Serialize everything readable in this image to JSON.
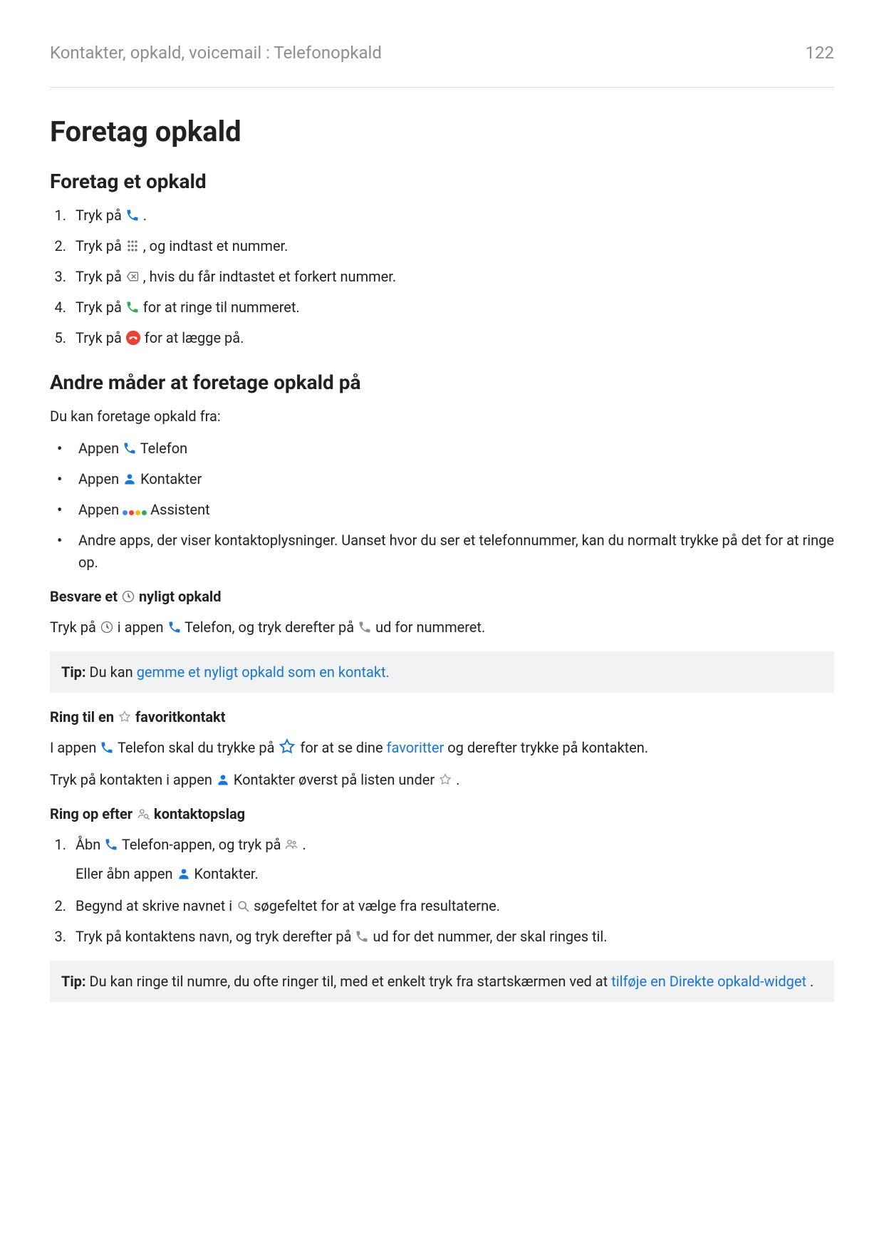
{
  "header": {
    "breadcrumb": "Kontakter, opkald, voicemail : Telefonopkald",
    "page": "122"
  },
  "h1": "Foretag opkald",
  "sec1": {
    "title": "Foretag et opkald",
    "s1a": "Tryk på ",
    "s1b": ".",
    "s2a": "Tryk på ",
    "s2b": ", og indtast et nummer.",
    "s3a": "Tryk på ",
    "s3b": ", hvis du får indtastet et forkert nummer.",
    "s4a": "Tryk på ",
    "s4b": " for at ringe til nummeret.",
    "s5a": "Tryk på ",
    "s5b": " for at lægge på."
  },
  "sec2": {
    "title": "Andre måder at foretage opkald på",
    "intro": "Du kan foretage opkald fra:",
    "b1a": "Appen ",
    "b1b": " Telefon",
    "b2a": "Appen ",
    "b2b": " Kontakter",
    "b3a": "Appen ",
    "b3b": " Assistent",
    "b4": "Andre apps, der viser kontaktoplysninger. Uanset hvor du ser et telefonnummer, kan du normalt trykke på det for at ringe op."
  },
  "recent": {
    "h_a": "Besvare et ",
    "h_b": " nyligt opkald",
    "p_a": "Tryk på ",
    "p_b": " i appen ",
    "p_c": " Telefon, og tryk derefter på ",
    "p_d": " ud for nummeret."
  },
  "tip1": {
    "label": "Tip:",
    "a": " Du kan ",
    "link": "gemme et nyligt opkald som en kontakt."
  },
  "fav": {
    "h_a": "Ring til en ",
    "h_b": " favoritkontakt",
    "p1_a": "I appen ",
    "p1_b": " Telefon skal du trykke på ",
    "p1_c": " for at se dine ",
    "p1_link": "favoritter",
    "p1_d": " og derefter trykke på kontakten.",
    "p2_a": "Tryk på kontakten i appen ",
    "p2_b": " Kontakter øverst på listen under ",
    "p2_c": "."
  },
  "search": {
    "h_a": "Ring op efter ",
    "h_b": " kontaktopslag",
    "s1_a": "Åbn ",
    "s1_b": " Telefon-appen, og tryk på ",
    "s1_c": ".",
    "s1_alt_a": "Eller åbn appen ",
    "s1_alt_b": " Kontakter.",
    "s2_a": "Begynd at skrive navnet i ",
    "s2_b": " søgefeltet for at vælge fra resultaterne.",
    "s3_a": "Tryk på kontaktens navn, og tryk derefter på ",
    "s3_b": " ud for det nummer, der skal ringes til."
  },
  "tip2": {
    "label": "Tip:",
    "a": " Du kan ringe til numre, du ofte ringer til, med et enkelt tryk fra startskærmen ved at ",
    "link": "tilføje en Direkte opkald-widget",
    "b": "."
  }
}
